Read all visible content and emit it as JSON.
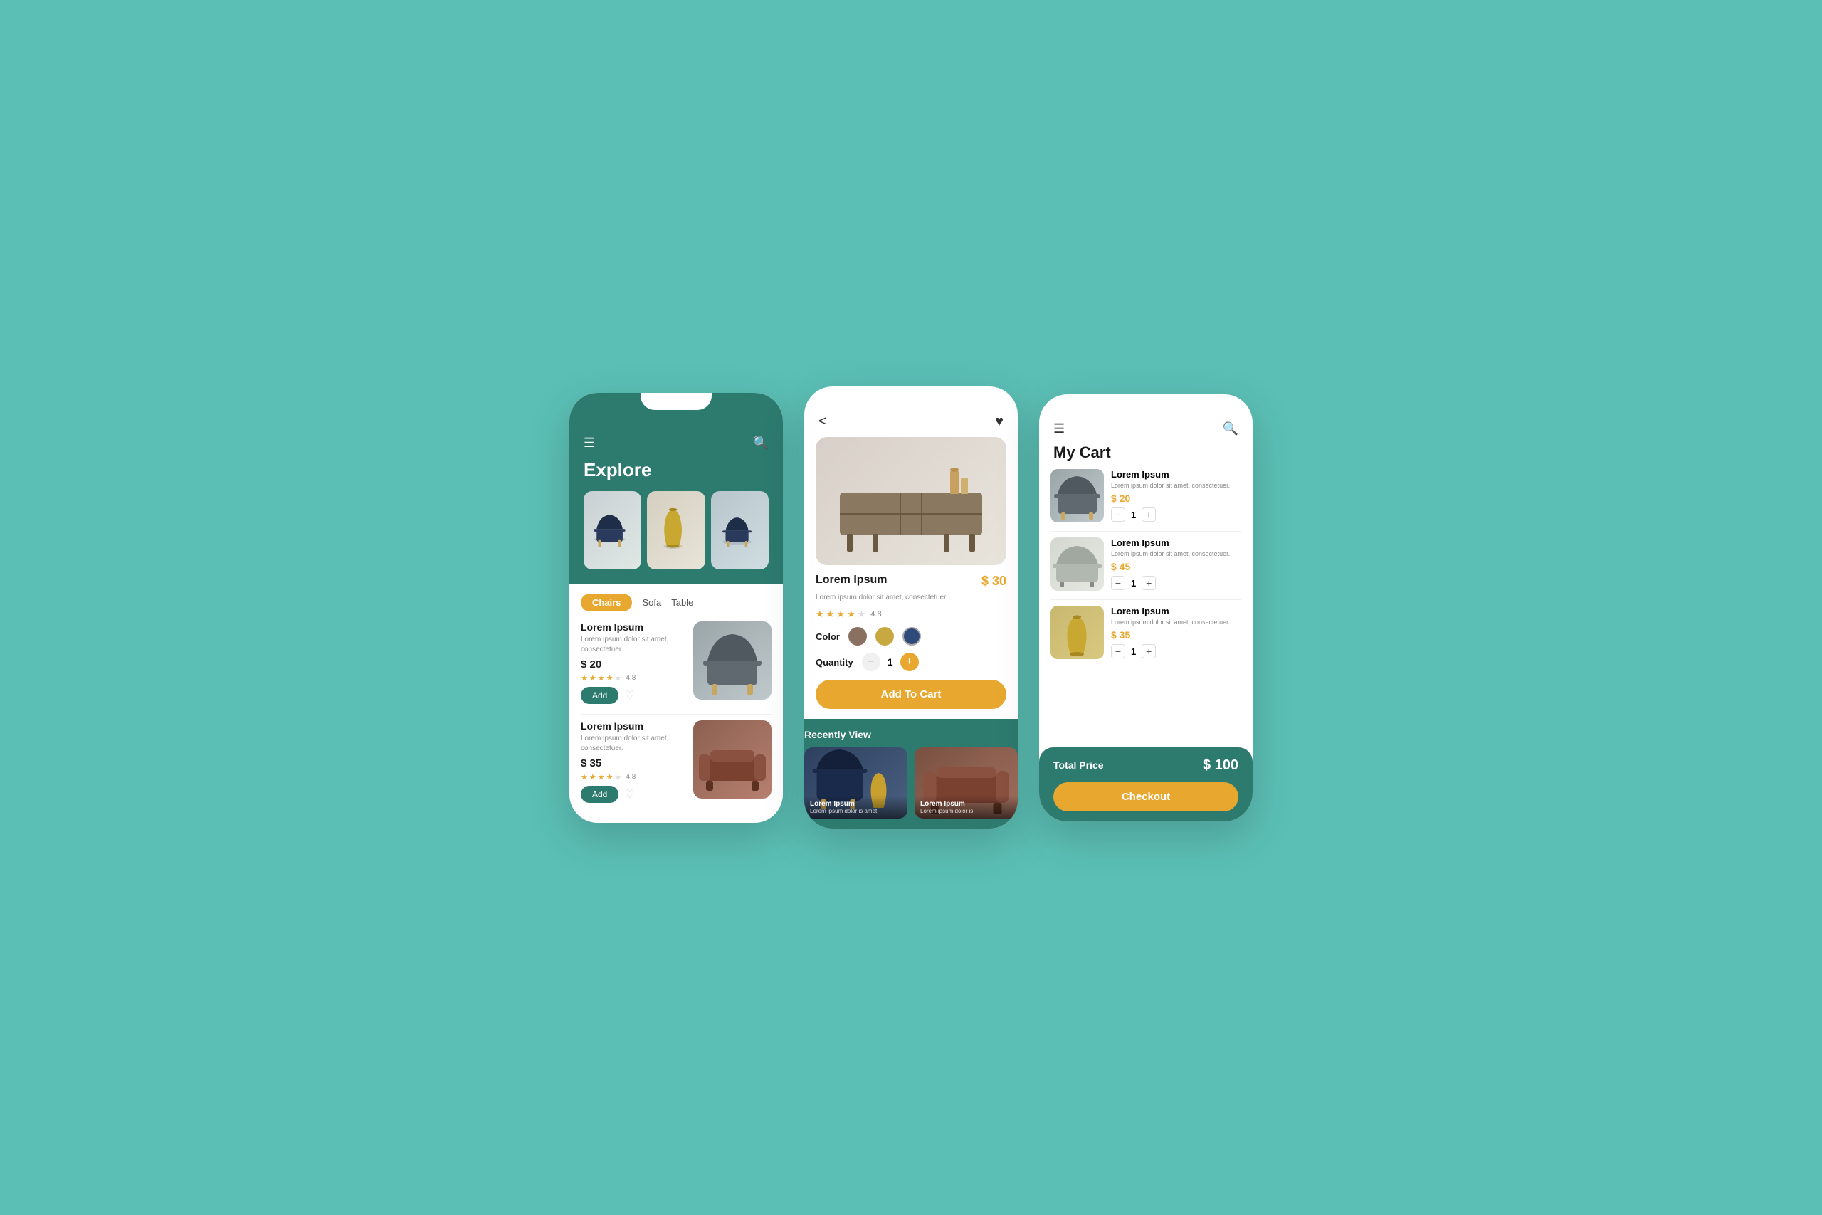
{
  "app": {
    "background": "#5bbfb5",
    "brand_color": "#2d7a6e",
    "accent_color": "#e8a830"
  },
  "phone1": {
    "title": "Explore",
    "menu_icon": "☰",
    "search_icon": "🔍",
    "categories": [
      {
        "label": "Chairs",
        "active": true
      },
      {
        "label": "Sofa",
        "active": false
      },
      {
        "label": "Table",
        "active": false
      }
    ],
    "hero_images": [
      {
        "alt": "Blue Chair"
      },
      {
        "alt": "Yellow Vase"
      },
      {
        "alt": "Blue Chair 2"
      }
    ],
    "products": [
      {
        "name": "Lorem Ipsum",
        "description": "Lorem ipsum dolor sit amet, consectetuer.",
        "price": "$ 20",
        "rating": "4.8",
        "stars": 4,
        "add_label": "Add"
      },
      {
        "name": "Lorem Ipsum",
        "description": "Lorem ipsum dolor sit amet, consectetuer.",
        "price": "$ 35",
        "rating": "4.8",
        "stars": 4,
        "add_label": "Add"
      }
    ]
  },
  "phone2": {
    "back_icon": "<",
    "heart_icon": "♥",
    "product": {
      "name": "Lorem Ipsum",
      "description": "Lorem ipsum dolor sit amet, consectetuer.",
      "price": "$ 30",
      "rating": "4.8",
      "stars": 4,
      "colors": [
        {
          "hex": "#8a7060",
          "label": "brown"
        },
        {
          "hex": "#c8a840",
          "label": "gold"
        },
        {
          "hex": "#2d4a7a",
          "label": "navy"
        }
      ],
      "quantity": 1,
      "add_to_cart_label": "Add To Cart"
    },
    "recently_view": {
      "title": "Recently View",
      "items": [
        {
          "name": "Lorem Ipsum",
          "description": "Lorem ipsum dolor is amet."
        },
        {
          "name": "Lorem Ipsum",
          "description": "Lorem ipsum dolor is"
        }
      ]
    }
  },
  "phone3": {
    "menu_icon": "☰",
    "search_icon": "🔍",
    "title": "My Cart",
    "items": [
      {
        "name": "Lorem Ipsum",
        "description": "Lorem ipsum dolor sit amet, consectetuer.",
        "price": "$ 20",
        "quantity": 1
      },
      {
        "name": "Lorem Ipsum",
        "description": "Lorem ipsum dolor sit amet, consectetuer.",
        "price": "$ 45",
        "quantity": 1
      },
      {
        "name": "Lorem Ipsum",
        "description": "Lorem ipsum dolor sit amet, consectetuer.",
        "price": "$ 35",
        "quantity": 1
      }
    ],
    "total_label": "Total Price",
    "total_amount": "$ 100",
    "checkout_label": "Checkout"
  }
}
